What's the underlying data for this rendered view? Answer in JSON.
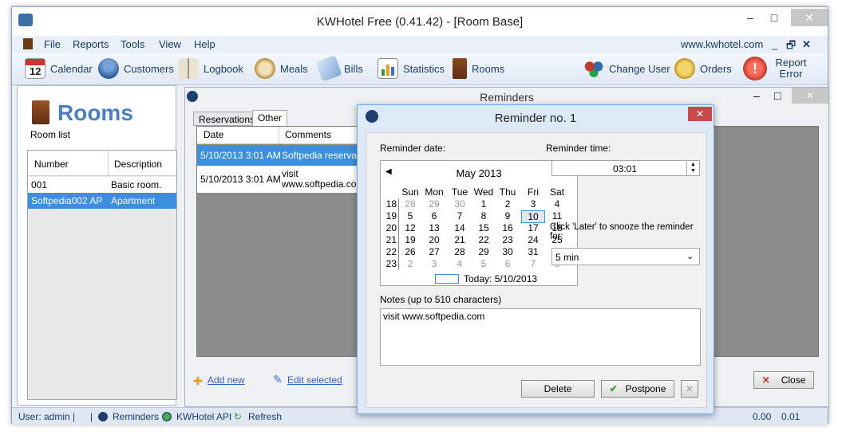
{
  "app": {
    "title": "KWHotel Free (0.41.42) - [Room Base]"
  },
  "menu": [
    "File",
    "Reports",
    "Tools",
    "View",
    "Help"
  ],
  "website": "www.kwhotel.com",
  "toolbar": {
    "calendar": "Calendar",
    "customers": "Customers",
    "logbook": "Logbook",
    "meals": "Meals",
    "bills": "Bills",
    "statistics": "Statistics",
    "rooms": "Rooms",
    "change_user": "Change User",
    "orders": "Orders",
    "report_error": "Report Error",
    "calendar_day": "12"
  },
  "rooms": {
    "title": "Rooms",
    "subtitle": "Room list",
    "columns": [
      "Number",
      "Description"
    ],
    "rows": [
      {
        "number": "001",
        "description": "Basic room."
      },
      {
        "number": "Softpedia002 AP",
        "description": "Apartment"
      }
    ]
  },
  "reminders": {
    "title": "Reminders",
    "tabs": [
      "Reservations",
      "Other"
    ],
    "columns": [
      "Date",
      "Comments"
    ],
    "rows": [
      {
        "date": "5/10/2013 3:01 AM",
        "comment": "Softpedia reservation"
      },
      {
        "date": "5/10/2013 3:01 AM",
        "comment": "visit www.softpedia.com"
      }
    ],
    "add_new": "Add new",
    "edit_selected": "Edit selected",
    "close": "Close"
  },
  "dialog": {
    "title": "Reminder no. 1",
    "date_label": "Reminder date:",
    "time_label": "Reminder time:",
    "time_value": "03:01",
    "month": "May 2013",
    "weekdays": [
      "Sun",
      "Mon",
      "Tue",
      "Wed",
      "Thu",
      "Fri",
      "Sat"
    ],
    "weeks": [
      "18",
      "19",
      "20",
      "21",
      "22",
      "23"
    ],
    "days": [
      [
        "28",
        "29",
        "30",
        "1",
        "2",
        "3",
        "4"
      ],
      [
        "5",
        "6",
        "7",
        "8",
        "9",
        "10",
        "11"
      ],
      [
        "12",
        "13",
        "14",
        "15",
        "16",
        "17",
        "18"
      ],
      [
        "19",
        "20",
        "21",
        "22",
        "23",
        "24",
        "25"
      ],
      [
        "26",
        "27",
        "28",
        "29",
        "30",
        "31",
        "1"
      ],
      [
        "2",
        "3",
        "4",
        "5",
        "6",
        "7",
        "8"
      ]
    ],
    "today": "Today: 5/10/2013",
    "snooze_label": "Click 'Later' to snooze the reminder for:",
    "snooze_value": "5 min",
    "notes_label": "Notes (up to 510 characters)",
    "notes_value": "visit www.softpedia.com",
    "delete": "Delete",
    "postpone": "Postpone"
  },
  "status": {
    "user": "User: admin |",
    "reminders": "Reminders",
    "api": "KWHotel API",
    "refresh": "Refresh",
    "val1": "0.00",
    "val2": "0.01"
  }
}
